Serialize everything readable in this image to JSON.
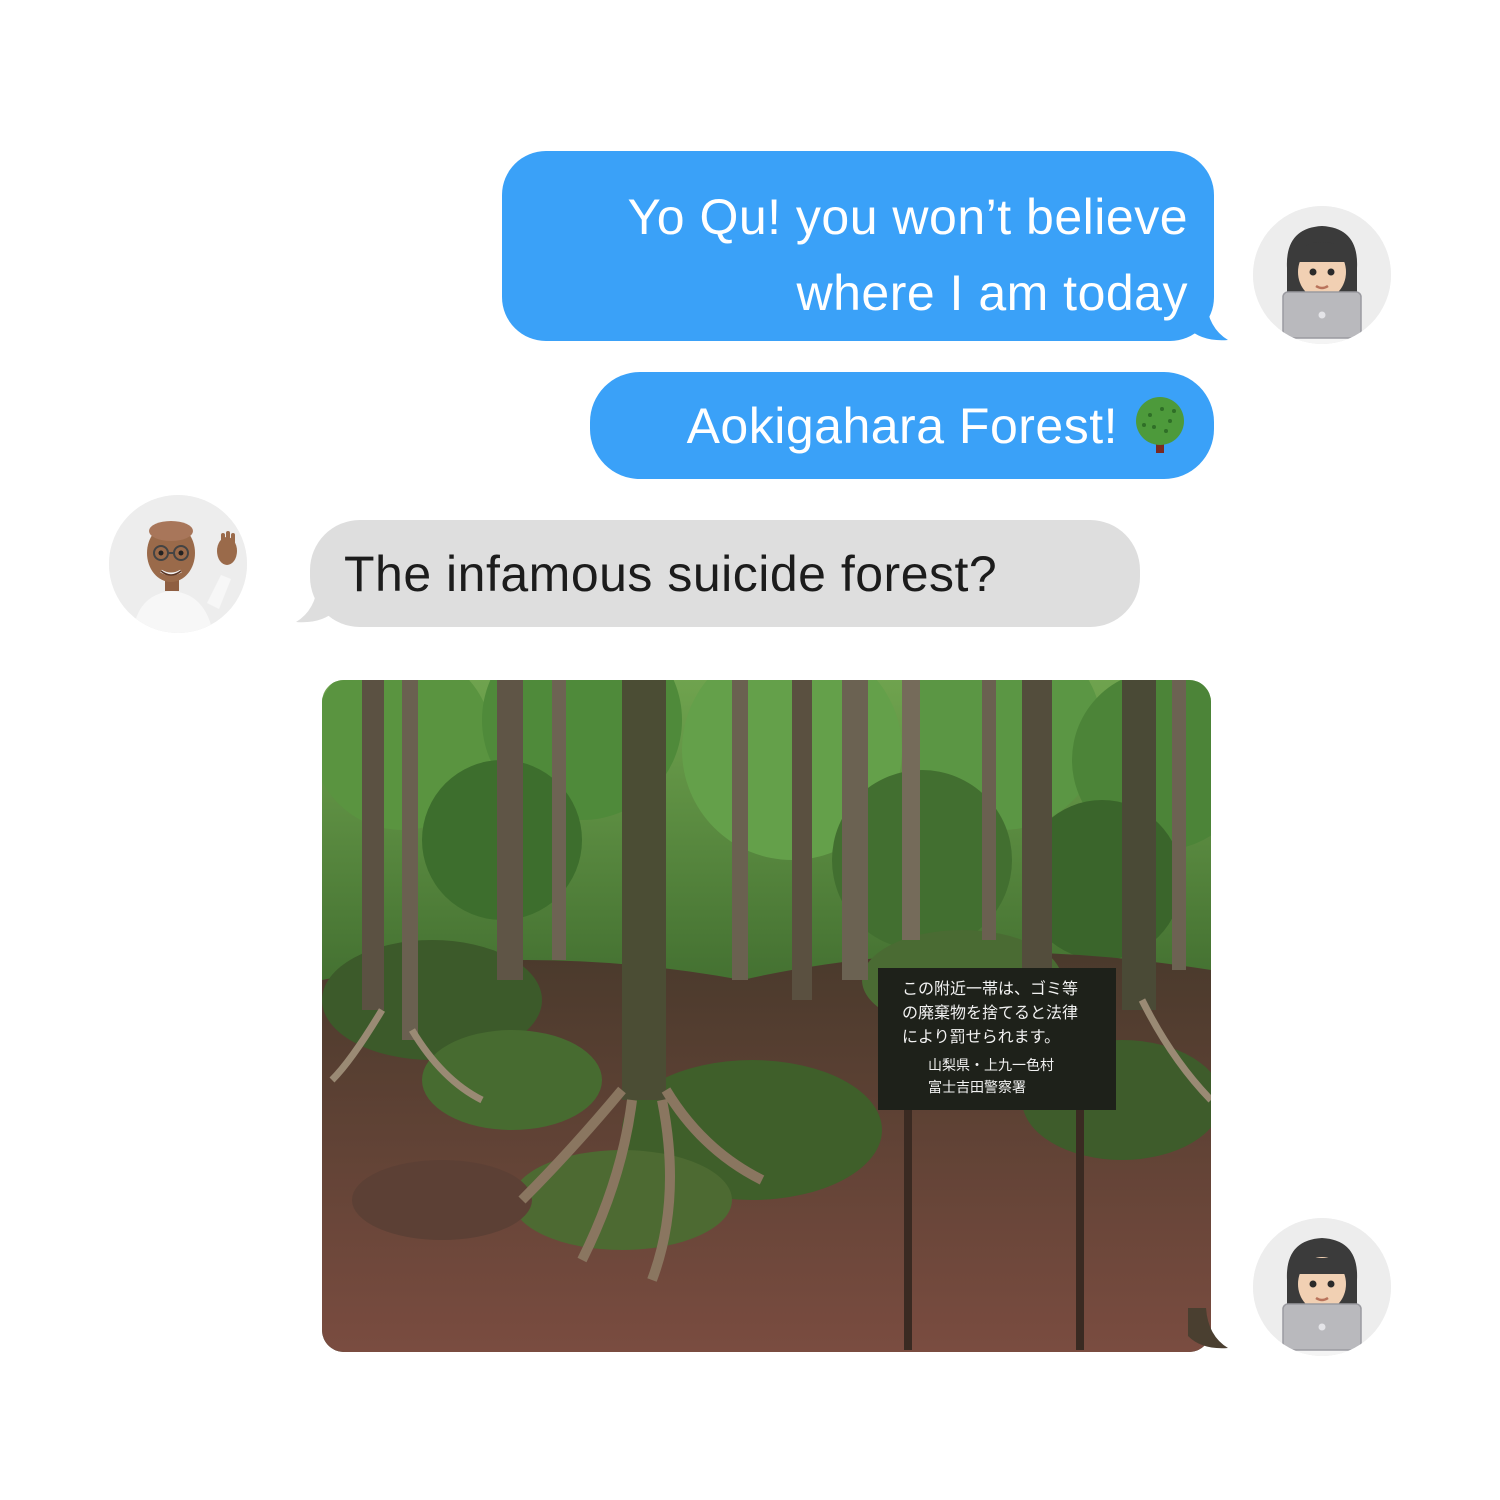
{
  "messages": [
    {
      "sender": "me",
      "lines": [
        "Yo Qu! you won’t believe",
        "where I am today"
      ]
    },
    {
      "sender": "me",
      "text": "Aokigahara Forest!",
      "emoji": "tree-icon"
    },
    {
      "sender": "friend",
      "text": "The infamous suicide forest?"
    }
  ],
  "photo": {
    "sign_lines": [
      "この附近一帯は、ゴミ等",
      "の廃棄物を捨てると法律",
      "により罰せられます。",
      "山梨県・上九一色村",
      "富士吉田警察署"
    ]
  },
  "colors": {
    "sent_bubble": "#3aa1f8",
    "received_bubble": "#dedede",
    "background": "#ffffff"
  },
  "icons": {
    "my_avatar": "memoji-girl-laptop-icon",
    "friend_avatar": "memoji-man-waving-icon"
  }
}
